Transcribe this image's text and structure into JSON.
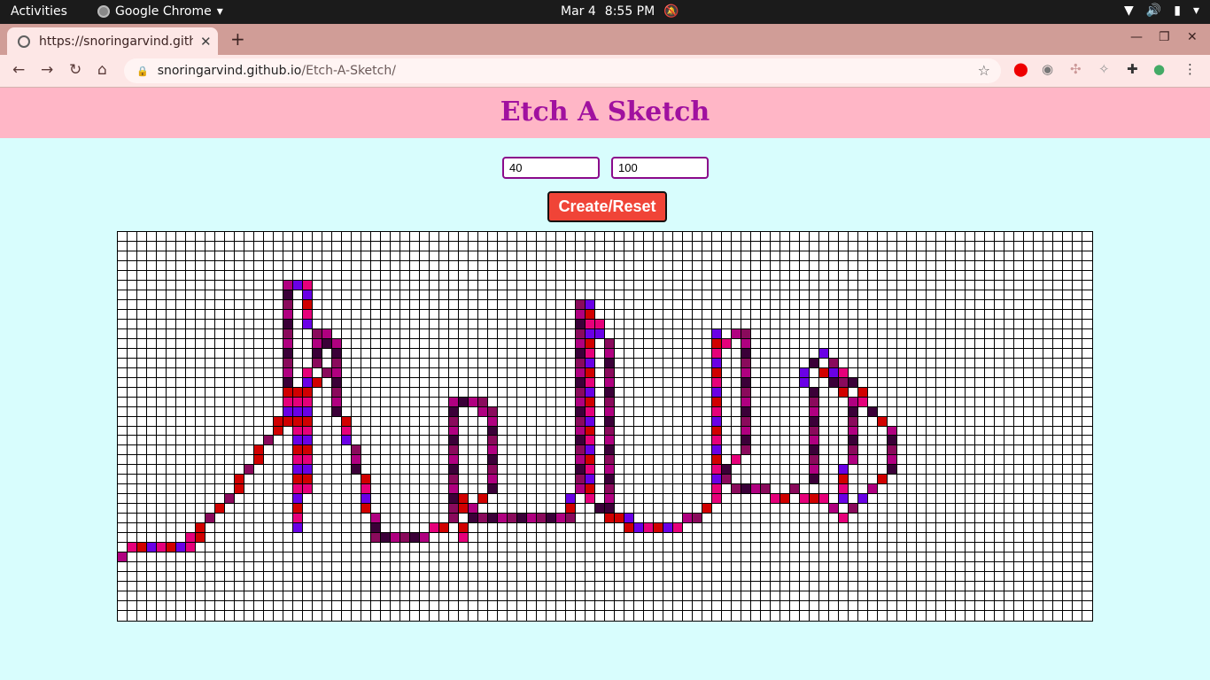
{
  "os": {
    "activities": "Activities",
    "app_name": "Google Chrome",
    "date": "Mar 4",
    "time": "8:55 PM"
  },
  "browser": {
    "tab_title": "https://snoringarvind.gith",
    "url_host": "snoringarvind.github.io",
    "url_path": "/Etch-A-Sketch/"
  },
  "page": {
    "title": "Etch A Sketch",
    "rows_value": "40",
    "cols_value": "100",
    "button_label": "Create/Reset"
  },
  "grid": {
    "rows": 40,
    "cols": 100,
    "palette": [
      "#e6007a",
      "#8a0a5c",
      "#6a00e6",
      "#b00080",
      "#d10000",
      "#3b0038"
    ],
    "drawn_cells": [
      [
        33,
        0
      ],
      [
        32,
        1
      ],
      [
        32,
        2
      ],
      [
        32,
        3
      ],
      [
        32,
        4
      ],
      [
        32,
        5
      ],
      [
        32,
        6
      ],
      [
        32,
        7
      ],
      [
        31,
        7
      ],
      [
        31,
        8
      ],
      [
        30,
        8
      ],
      [
        29,
        9
      ],
      [
        28,
        10
      ],
      [
        27,
        11
      ],
      [
        26,
        12
      ],
      [
        25,
        12
      ],
      [
        24,
        13
      ],
      [
        23,
        14
      ],
      [
        22,
        14
      ],
      [
        21,
        15
      ],
      [
        20,
        16
      ],
      [
        19,
        16
      ],
      [
        18,
        17
      ],
      [
        17,
        18
      ],
      [
        16,
        19
      ],
      [
        15,
        20
      ],
      [
        14,
        21
      ],
      [
        16,
        17
      ],
      [
        17,
        17
      ],
      [
        18,
        17
      ],
      [
        19,
        17
      ],
      [
        5,
        17
      ],
      [
        6,
        17
      ],
      [
        7,
        17
      ],
      [
        8,
        17
      ],
      [
        9,
        17
      ],
      [
        10,
        17
      ],
      [
        11,
        17
      ],
      [
        12,
        17
      ],
      [
        13,
        17
      ],
      [
        14,
        17
      ],
      [
        15,
        17
      ],
      [
        16,
        18
      ],
      [
        17,
        18
      ],
      [
        18,
        18
      ],
      [
        19,
        18
      ],
      [
        20,
        18
      ],
      [
        21,
        18
      ],
      [
        22,
        18
      ],
      [
        23,
        18
      ],
      [
        24,
        18
      ],
      [
        25,
        18
      ],
      [
        26,
        18
      ],
      [
        27,
        18
      ],
      [
        28,
        18
      ],
      [
        29,
        18
      ],
      [
        30,
        18
      ],
      [
        5,
        18
      ],
      [
        5,
        19
      ],
      [
        6,
        19
      ],
      [
        7,
        19
      ],
      [
        8,
        19
      ],
      [
        9,
        19
      ],
      [
        10,
        20
      ],
      [
        11,
        20
      ],
      [
        12,
        20
      ],
      [
        13,
        20
      ],
      [
        14,
        19
      ],
      [
        15,
        19
      ],
      [
        16,
        19
      ],
      [
        17,
        19
      ],
      [
        18,
        19
      ],
      [
        19,
        19
      ],
      [
        20,
        19
      ],
      [
        21,
        19
      ],
      [
        22,
        19
      ],
      [
        23,
        19
      ],
      [
        24,
        19
      ],
      [
        25,
        19
      ],
      [
        26,
        19
      ],
      [
        10,
        21
      ],
      [
        11,
        21
      ],
      [
        11,
        22
      ],
      [
        12,
        22
      ],
      [
        13,
        22
      ],
      [
        14,
        22
      ],
      [
        15,
        22
      ],
      [
        16,
        22
      ],
      [
        17,
        22
      ],
      [
        18,
        22
      ],
      [
        19,
        23
      ],
      [
        20,
        23
      ],
      [
        21,
        23
      ],
      [
        22,
        24
      ],
      [
        23,
        24
      ],
      [
        24,
        24
      ],
      [
        25,
        25
      ],
      [
        26,
        25
      ],
      [
        27,
        25
      ],
      [
        28,
        25
      ],
      [
        29,
        26
      ],
      [
        30,
        26
      ],
      [
        31,
        26
      ],
      [
        31,
        27
      ],
      [
        31,
        28
      ],
      [
        31,
        29
      ],
      [
        31,
        30
      ],
      [
        31,
        31
      ],
      [
        30,
        32
      ],
      [
        30,
        33
      ],
      [
        29,
        34
      ],
      [
        28,
        34
      ],
      [
        17,
        34
      ],
      [
        18,
        34
      ],
      [
        19,
        34
      ],
      [
        20,
        34
      ],
      [
        21,
        34
      ],
      [
        22,
        34
      ],
      [
        23,
        34
      ],
      [
        24,
        34
      ],
      [
        25,
        34
      ],
      [
        26,
        34
      ],
      [
        27,
        34
      ],
      [
        17,
        35
      ],
      [
        17,
        36
      ],
      [
        17,
        37
      ],
      [
        18,
        37
      ],
      [
        18,
        38
      ],
      [
        19,
        38
      ],
      [
        20,
        38
      ],
      [
        21,
        38
      ],
      [
        22,
        38
      ],
      [
        23,
        38
      ],
      [
        24,
        38
      ],
      [
        25,
        38
      ],
      [
        26,
        38
      ],
      [
        27,
        37
      ],
      [
        28,
        36
      ],
      [
        29,
        36
      ],
      [
        30,
        35
      ],
      [
        31,
        35
      ],
      [
        28,
        35
      ],
      [
        27,
        35
      ],
      [
        29,
        37
      ],
      [
        29,
        38
      ],
      [
        29,
        39
      ],
      [
        29,
        40
      ],
      [
        29,
        41
      ],
      [
        29,
        42
      ],
      [
        29,
        43
      ],
      [
        29,
        44
      ],
      [
        29,
        45
      ],
      [
        29,
        46
      ],
      [
        7,
        47
      ],
      [
        8,
        47
      ],
      [
        9,
        47
      ],
      [
        10,
        47
      ],
      [
        11,
        47
      ],
      [
        12,
        47
      ],
      [
        13,
        47
      ],
      [
        14,
        47
      ],
      [
        15,
        47
      ],
      [
        16,
        47
      ],
      [
        17,
        47
      ],
      [
        18,
        47
      ],
      [
        19,
        47
      ],
      [
        20,
        47
      ],
      [
        21,
        47
      ],
      [
        22,
        47
      ],
      [
        23,
        47
      ],
      [
        24,
        47
      ],
      [
        25,
        47
      ],
      [
        26,
        47
      ],
      [
        27,
        46
      ],
      [
        28,
        46
      ],
      [
        7,
        48
      ],
      [
        8,
        48
      ],
      [
        9,
        48
      ],
      [
        10,
        48
      ],
      [
        11,
        48
      ],
      [
        12,
        48
      ],
      [
        13,
        48
      ],
      [
        14,
        48
      ],
      [
        15,
        48
      ],
      [
        16,
        48
      ],
      [
        17,
        48
      ],
      [
        18,
        48
      ],
      [
        19,
        48
      ],
      [
        20,
        48
      ],
      [
        21,
        48
      ],
      [
        22,
        48
      ],
      [
        23,
        48
      ],
      [
        24,
        48
      ],
      [
        25,
        48
      ],
      [
        26,
        48
      ],
      [
        27,
        48
      ],
      [
        28,
        49
      ],
      [
        29,
        50
      ],
      [
        9,
        49
      ],
      [
        10,
        49
      ],
      [
        11,
        50
      ],
      [
        12,
        50
      ],
      [
        13,
        50
      ],
      [
        14,
        50
      ],
      [
        15,
        50
      ],
      [
        16,
        50
      ],
      [
        17,
        50
      ],
      [
        18,
        50
      ],
      [
        19,
        50
      ],
      [
        20,
        50
      ],
      [
        21,
        50
      ],
      [
        22,
        50
      ],
      [
        23,
        50
      ],
      [
        24,
        50
      ],
      [
        25,
        50
      ],
      [
        26,
        50
      ],
      [
        27,
        50
      ],
      [
        28,
        50
      ],
      [
        29,
        51
      ],
      [
        29,
        52
      ],
      [
        30,
        52
      ],
      [
        30,
        53
      ],
      [
        30,
        54
      ],
      [
        30,
        55
      ],
      [
        30,
        56
      ],
      [
        30,
        57
      ],
      [
        29,
        58
      ],
      [
        29,
        59
      ],
      [
        28,
        60
      ],
      [
        10,
        61
      ],
      [
        11,
        61
      ],
      [
        12,
        61
      ],
      [
        13,
        61
      ],
      [
        14,
        61
      ],
      [
        15,
        61
      ],
      [
        16,
        61
      ],
      [
        17,
        61
      ],
      [
        18,
        61
      ],
      [
        19,
        61
      ],
      [
        20,
        61
      ],
      [
        21,
        61
      ],
      [
        22,
        61
      ],
      [
        23,
        61
      ],
      [
        24,
        61
      ],
      [
        25,
        61
      ],
      [
        26,
        61
      ],
      [
        27,
        61
      ],
      [
        11,
        62
      ],
      [
        10,
        63
      ],
      [
        10,
        64
      ],
      [
        11,
        64
      ],
      [
        12,
        64
      ],
      [
        13,
        64
      ],
      [
        14,
        64
      ],
      [
        15,
        64
      ],
      [
        16,
        64
      ],
      [
        17,
        64
      ],
      [
        18,
        64
      ],
      [
        19,
        64
      ],
      [
        20,
        64
      ],
      [
        21,
        64
      ],
      [
        22,
        64
      ],
      [
        23,
        63
      ],
      [
        24,
        62
      ],
      [
        25,
        62
      ],
      [
        26,
        61
      ],
      [
        26,
        63
      ],
      [
        26,
        64
      ],
      [
        26,
        65
      ],
      [
        26,
        66
      ],
      [
        27,
        67
      ],
      [
        27,
        68
      ],
      [
        26,
        69
      ],
      [
        27,
        70
      ],
      [
        27,
        71
      ],
      [
        15,
        70
      ],
      [
        14,
        70
      ],
      [
        13,
        71
      ],
      [
        12,
        72
      ],
      [
        13,
        73
      ],
      [
        14,
        74
      ],
      [
        15,
        75
      ],
      [
        16,
        76
      ],
      [
        17,
        76
      ],
      [
        18,
        77
      ],
      [
        19,
        78
      ],
      [
        20,
        79
      ],
      [
        21,
        79
      ],
      [
        22,
        79
      ],
      [
        23,
        79
      ],
      [
        24,
        79
      ],
      [
        25,
        78
      ],
      [
        26,
        77
      ],
      [
        27,
        76
      ],
      [
        28,
        75
      ],
      [
        29,
        74
      ],
      [
        28,
        73
      ],
      [
        27,
        72
      ],
      [
        16,
        71
      ],
      [
        17,
        71
      ],
      [
        18,
        71
      ],
      [
        19,
        71
      ],
      [
        20,
        71
      ],
      [
        21,
        71
      ],
      [
        22,
        71
      ],
      [
        23,
        71
      ],
      [
        24,
        71
      ],
      [
        25,
        71
      ],
      [
        14,
        72
      ],
      [
        14,
        73
      ],
      [
        15,
        74
      ],
      [
        15,
        73
      ],
      [
        16,
        74
      ],
      [
        17,
        75
      ],
      [
        18,
        75
      ],
      [
        19,
        75
      ],
      [
        20,
        75
      ],
      [
        21,
        75
      ],
      [
        22,
        75
      ],
      [
        23,
        75
      ],
      [
        24,
        74
      ],
      [
        25,
        74
      ],
      [
        26,
        74
      ],
      [
        27,
        74
      ]
    ]
  }
}
